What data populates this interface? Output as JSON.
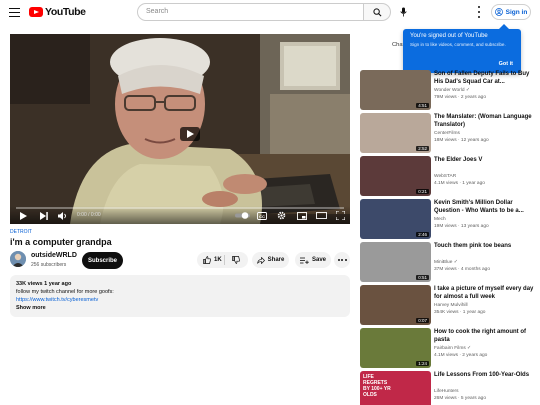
{
  "header": {
    "logo_text": "YouTube",
    "search_placeholder": "Search",
    "signin_label": "Sign in"
  },
  "popup": {
    "title": "You're signed out of YouTube",
    "text": "Sign in to like videos, comment, and subscribe.",
    "button": "Got it"
  },
  "chat_peek": "Chat",
  "player": {
    "time": "0:00 / 0:00"
  },
  "video": {
    "location": "DETROIT",
    "title": "i'm a computer grandpa",
    "channel": "outsideWRLD",
    "subscribers": "256 subscribers",
    "subscribe_label": "Subscribe",
    "likes": "1K",
    "share_label": "Share",
    "save_label": "Save",
    "views_line": "33K views  1 year ago",
    "desc_line1": "follow my twitch channel for more goofs:",
    "desc_link": "https://www.twitch.tv/cyberesmetv",
    "show_more": "Show more"
  },
  "recommendations": [
    {
      "title": "Son of Fallen Deputy Fails to Buy His Dad's Squad Car at...",
      "channel": "Wonder World",
      "meta": "79M views · 2 years ago",
      "duration": "4:51",
      "verified": true,
      "thumb_color": "#7a6a5a"
    },
    {
      "title": "The Manslater: (Woman Language Translator)",
      "channel": "CenterFilms",
      "meta": "18M views · 12 years ago",
      "duration": "2:52",
      "verified": false,
      "thumb_color": "#b9a89a"
    },
    {
      "title": "The Elder Joes V",
      "channel": "WebSTAR",
      "meta": "4.1M views · 1 year ago",
      "duration": "0:21",
      "verified": false,
      "thumb_color": "#5c3a3a"
    },
    {
      "title": "Kevin Smith's Million Dollar Question - Who Wants to be a...",
      "channel": "Mech",
      "meta": "19M views · 13 years ago",
      "duration": "2:46",
      "verified": false,
      "thumb_color": "#3d4a6a"
    },
    {
      "title": "Touch them pink toe beans",
      "channel": "MiniBlue",
      "meta": "37M views · 4 months ago",
      "duration": "0:51",
      "verified": true,
      "thumb_color": "#9a9a9a"
    },
    {
      "title": "I take a picture of myself every day for almost a full week",
      "channel": "Harvey Mulvihill",
      "meta": "354K views · 1 year ago",
      "duration": "0:07",
      "verified": false,
      "thumb_color": "#6a5240"
    },
    {
      "title": "How to cook the right amount of pasta",
      "channel": "Fairbairn Films",
      "meta": "4.1M views · 2 years ago",
      "duration": "1:24",
      "verified": true,
      "thumb_color": "#6a7a3a"
    },
    {
      "title": "Life Lessons From 100-Year-Olds",
      "channel": "LifeHunters",
      "meta": "26M views · 5 years ago",
      "duration": "",
      "verified": false,
      "thumb_color": "#c02848",
      "thumb_text": "LIFE REGRETS BY 100+ YR OLDS"
    }
  ]
}
